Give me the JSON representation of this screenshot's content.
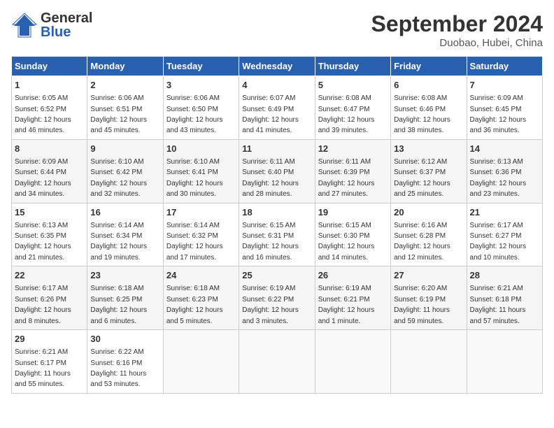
{
  "header": {
    "logo_line1": "General",
    "logo_line2": "Blue",
    "month": "September 2024",
    "location": "Duobao, Hubei, China"
  },
  "weekdays": [
    "Sunday",
    "Monday",
    "Tuesday",
    "Wednesday",
    "Thursday",
    "Friday",
    "Saturday"
  ],
  "weeks": [
    [
      {
        "day": "1",
        "info": "Sunrise: 6:05 AM\nSunset: 6:52 PM\nDaylight: 12 hours\nand 46 minutes."
      },
      {
        "day": "2",
        "info": "Sunrise: 6:06 AM\nSunset: 6:51 PM\nDaylight: 12 hours\nand 45 minutes."
      },
      {
        "day": "3",
        "info": "Sunrise: 6:06 AM\nSunset: 6:50 PM\nDaylight: 12 hours\nand 43 minutes."
      },
      {
        "day": "4",
        "info": "Sunrise: 6:07 AM\nSunset: 6:49 PM\nDaylight: 12 hours\nand 41 minutes."
      },
      {
        "day": "5",
        "info": "Sunrise: 6:08 AM\nSunset: 6:47 PM\nDaylight: 12 hours\nand 39 minutes."
      },
      {
        "day": "6",
        "info": "Sunrise: 6:08 AM\nSunset: 6:46 PM\nDaylight: 12 hours\nand 38 minutes."
      },
      {
        "day": "7",
        "info": "Sunrise: 6:09 AM\nSunset: 6:45 PM\nDaylight: 12 hours\nand 36 minutes."
      }
    ],
    [
      {
        "day": "8",
        "info": "Sunrise: 6:09 AM\nSunset: 6:44 PM\nDaylight: 12 hours\nand 34 minutes."
      },
      {
        "day": "9",
        "info": "Sunrise: 6:10 AM\nSunset: 6:42 PM\nDaylight: 12 hours\nand 32 minutes."
      },
      {
        "day": "10",
        "info": "Sunrise: 6:10 AM\nSunset: 6:41 PM\nDaylight: 12 hours\nand 30 minutes."
      },
      {
        "day": "11",
        "info": "Sunrise: 6:11 AM\nSunset: 6:40 PM\nDaylight: 12 hours\nand 28 minutes."
      },
      {
        "day": "12",
        "info": "Sunrise: 6:11 AM\nSunset: 6:39 PM\nDaylight: 12 hours\nand 27 minutes."
      },
      {
        "day": "13",
        "info": "Sunrise: 6:12 AM\nSunset: 6:37 PM\nDaylight: 12 hours\nand 25 minutes."
      },
      {
        "day": "14",
        "info": "Sunrise: 6:13 AM\nSunset: 6:36 PM\nDaylight: 12 hours\nand 23 minutes."
      }
    ],
    [
      {
        "day": "15",
        "info": "Sunrise: 6:13 AM\nSunset: 6:35 PM\nDaylight: 12 hours\nand 21 minutes."
      },
      {
        "day": "16",
        "info": "Sunrise: 6:14 AM\nSunset: 6:34 PM\nDaylight: 12 hours\nand 19 minutes."
      },
      {
        "day": "17",
        "info": "Sunrise: 6:14 AM\nSunset: 6:32 PM\nDaylight: 12 hours\nand 17 minutes."
      },
      {
        "day": "18",
        "info": "Sunrise: 6:15 AM\nSunset: 6:31 PM\nDaylight: 12 hours\nand 16 minutes."
      },
      {
        "day": "19",
        "info": "Sunrise: 6:15 AM\nSunset: 6:30 PM\nDaylight: 12 hours\nand 14 minutes."
      },
      {
        "day": "20",
        "info": "Sunrise: 6:16 AM\nSunset: 6:28 PM\nDaylight: 12 hours\nand 12 minutes."
      },
      {
        "day": "21",
        "info": "Sunrise: 6:17 AM\nSunset: 6:27 PM\nDaylight: 12 hours\nand 10 minutes."
      }
    ],
    [
      {
        "day": "22",
        "info": "Sunrise: 6:17 AM\nSunset: 6:26 PM\nDaylight: 12 hours\nand 8 minutes."
      },
      {
        "day": "23",
        "info": "Sunrise: 6:18 AM\nSunset: 6:25 PM\nDaylight: 12 hours\nand 6 minutes."
      },
      {
        "day": "24",
        "info": "Sunrise: 6:18 AM\nSunset: 6:23 PM\nDaylight: 12 hours\nand 5 minutes."
      },
      {
        "day": "25",
        "info": "Sunrise: 6:19 AM\nSunset: 6:22 PM\nDaylight: 12 hours\nand 3 minutes."
      },
      {
        "day": "26",
        "info": "Sunrise: 6:19 AM\nSunset: 6:21 PM\nDaylight: 12 hours\nand 1 minute."
      },
      {
        "day": "27",
        "info": "Sunrise: 6:20 AM\nSunset: 6:19 PM\nDaylight: 11 hours\nand 59 minutes."
      },
      {
        "day": "28",
        "info": "Sunrise: 6:21 AM\nSunset: 6:18 PM\nDaylight: 11 hours\nand 57 minutes."
      }
    ],
    [
      {
        "day": "29",
        "info": "Sunrise: 6:21 AM\nSunset: 6:17 PM\nDaylight: 11 hours\nand 55 minutes."
      },
      {
        "day": "30",
        "info": "Sunrise: 6:22 AM\nSunset: 6:16 PM\nDaylight: 11 hours\nand 53 minutes."
      },
      {
        "day": "",
        "info": ""
      },
      {
        "day": "",
        "info": ""
      },
      {
        "day": "",
        "info": ""
      },
      {
        "day": "",
        "info": ""
      },
      {
        "day": "",
        "info": ""
      }
    ]
  ]
}
